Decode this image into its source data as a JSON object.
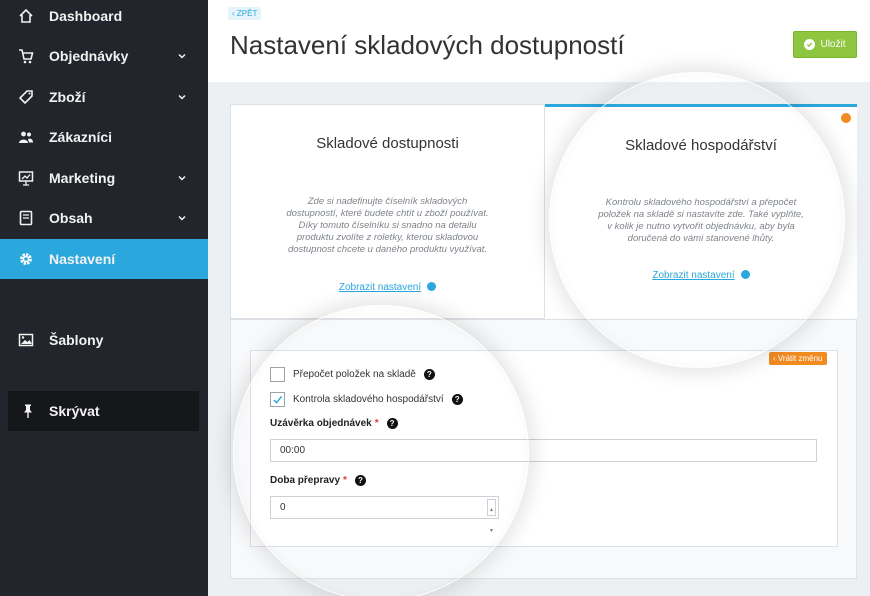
{
  "sidebar": {
    "items": [
      {
        "label": "Dashboard",
        "icon": "home-icon"
      },
      {
        "label": "Objednávky",
        "icon": "cart-icon"
      },
      {
        "label": "Zboží",
        "icon": "tag-icon"
      },
      {
        "label": "Zákazníci",
        "icon": "users-icon"
      },
      {
        "label": "Marketing",
        "icon": "presentation-icon"
      },
      {
        "label": "Obsah",
        "icon": "book-icon"
      },
      {
        "label": "Nastavení",
        "icon": "gear-icon"
      },
      {
        "label": "Šablony",
        "icon": "image-icon"
      },
      {
        "label": "Skrývat",
        "icon": "pin-icon"
      }
    ],
    "active_color": "#2aa7dc"
  },
  "header": {
    "back_label": "ZPĚT",
    "title": "Nastavení skladových dostupností",
    "save_label": "Uložit"
  },
  "tabs": [
    {
      "title": "Skladové dostupnosti",
      "description": "Zde si nadefinujte číselník skladových dostupností, které budete chtít u zboží používat. Díky tomuto číselníku si snadno na detailu produktu zvolíte z roletky, kterou skladovou dostupnost chcete u daného produktu využívat.",
      "link": "Zobrazit nastavení"
    },
    {
      "title": "Skladové hospodářství",
      "description": "Kontrolu skladového hospodářství a přepočet položek na skladě si nastavíte zde. Také vyplňte, v kolik je nutno vytvořit objednávku, aby byla doručená do vámi stanovené lhůty.",
      "link": "Zobrazit nastavení"
    }
  ],
  "form": {
    "revert_label": "Vrátit změnu",
    "checkbox1": {
      "label": "Přepočet položek na skladě",
      "checked": false
    },
    "checkbox2": {
      "label": "Kontrola skladového hospodářství",
      "checked": true
    },
    "field1": {
      "label": "Uzávěrka objednávek",
      "value": "00:00"
    },
    "field2": {
      "label": "Doba přepravy",
      "value": "0"
    },
    "required_mark": "*",
    "help_mark": "?"
  },
  "colors": {
    "accent": "#2aa7dc",
    "save": "#8ec63f",
    "orange": "#f28b20"
  }
}
